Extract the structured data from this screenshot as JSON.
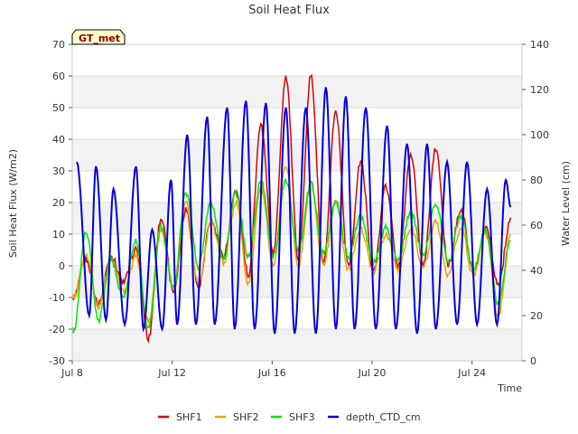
{
  "chart_data": {
    "type": "line",
    "title": "Soil Heat Flux",
    "xlabel": "Time",
    "ylabel": "Soil Heat Flux (W/m2)",
    "y2label": "Water Level (cm)",
    "badge": "GT_met",
    "xlim": [
      8.0,
      26.0
    ],
    "ylim": [
      -30,
      70
    ],
    "y2lim": [
      0,
      140
    ],
    "x_ticks": [
      {
        "x": 8,
        "label": "Jul 8"
      },
      {
        "x": 12,
        "label": "Jul 12"
      },
      {
        "x": 16,
        "label": "Jul 16"
      },
      {
        "x": 20,
        "label": "Jul 20"
      },
      {
        "x": 24,
        "label": "Jul 24"
      }
    ],
    "y_ticks": [
      -30,
      -20,
      -10,
      0,
      10,
      20,
      30,
      40,
      50,
      60,
      70
    ],
    "y2_ticks": [
      0,
      20,
      40,
      60,
      80,
      100,
      120,
      140
    ],
    "grid": "horizontal bands",
    "legend_position": "bottom",
    "series": [
      {
        "name": "SHF1",
        "color": "#dd0000",
        "axis": "left",
        "daily": [
          {
            "day": 8,
            "max": 2,
            "min": -10
          },
          {
            "day": 9,
            "max": 3,
            "min": -12
          },
          {
            "day": 10,
            "max": 5,
            "min": -5
          },
          {
            "day": 11,
            "max": 15,
            "min": -23
          },
          {
            "day": 12,
            "max": 18,
            "min": -8
          },
          {
            "day": 13,
            "max": 14,
            "min": -7
          },
          {
            "day": 14,
            "max": 24,
            "min": 3
          },
          {
            "day": 15,
            "max": 44,
            "min": -3
          },
          {
            "day": 16,
            "max": 60,
            "min": 4
          },
          {
            "day": 17,
            "max": 60,
            "min": 2
          },
          {
            "day": 18,
            "max": 49,
            "min": 0
          },
          {
            "day": 19,
            "max": 33,
            "min": 0
          },
          {
            "day": 20,
            "max": 25,
            "min": -2
          },
          {
            "day": 21,
            "max": 35,
            "min": 0
          },
          {
            "day": 22,
            "max": 37,
            "min": 0
          },
          {
            "day": 23,
            "max": 18,
            "min": 0
          },
          {
            "day": 24,
            "max": 12,
            "min": -2
          },
          {
            "day": 25,
            "max": 15,
            "min": -6
          }
        ]
      },
      {
        "name": "SHF2",
        "color": "#f5a000",
        "axis": "left",
        "daily": [
          {
            "day": 8,
            "max": 3,
            "min": -10
          },
          {
            "day": 9,
            "max": 2,
            "min": -13
          },
          {
            "day": 10,
            "max": 3,
            "min": -8
          },
          {
            "day": 11,
            "max": 12,
            "min": -18
          },
          {
            "day": 12,
            "max": 20,
            "min": -7
          },
          {
            "day": 13,
            "max": 14,
            "min": -6
          },
          {
            "day": 14,
            "max": 20,
            "min": 1
          },
          {
            "day": 15,
            "max": 25,
            "min": -6
          },
          {
            "day": 16,
            "max": 32,
            "min": 0
          },
          {
            "day": 17,
            "max": 26,
            "min": 0
          },
          {
            "day": 18,
            "max": 20,
            "min": 0
          },
          {
            "day": 19,
            "max": 12,
            "min": -1
          },
          {
            "day": 20,
            "max": 10,
            "min": -2
          },
          {
            "day": 21,
            "max": 12,
            "min": -1
          },
          {
            "day": 22,
            "max": 14,
            "min": 0
          },
          {
            "day": 23,
            "max": 12,
            "min": -3
          },
          {
            "day": 24,
            "max": 10,
            "min": -3
          },
          {
            "day": 25,
            "max": 10,
            "min": -16
          }
        ]
      },
      {
        "name": "SHF3",
        "color": "#00e600",
        "axis": "left",
        "daily": [
          {
            "day": 8,
            "max": 11,
            "min": -21
          },
          {
            "day": 9,
            "max": 2,
            "min": -17
          },
          {
            "day": 10,
            "max": 8,
            "min": -10
          },
          {
            "day": 11,
            "max": 12,
            "min": -20
          },
          {
            "day": 12,
            "max": 23,
            "min": -7
          },
          {
            "day": 13,
            "max": 20,
            "min": 0
          },
          {
            "day": 14,
            "max": 23,
            "min": 2
          },
          {
            "day": 15,
            "max": 27,
            "min": 3
          },
          {
            "day": 16,
            "max": 27,
            "min": 3
          },
          {
            "day": 17,
            "max": 26,
            "min": 5
          },
          {
            "day": 18,
            "max": 20,
            "min": 4
          },
          {
            "day": 19,
            "max": 16,
            "min": 3
          },
          {
            "day": 20,
            "max": 12,
            "min": 1
          },
          {
            "day": 21,
            "max": 17,
            "min": 2
          },
          {
            "day": 22,
            "max": 20,
            "min": 3
          },
          {
            "day": 23,
            "max": 16,
            "min": 1
          },
          {
            "day": 24,
            "max": 11,
            "min": -1
          },
          {
            "day": 25,
            "max": 9,
            "min": -12
          }
        ]
      },
      {
        "name": "depth_CTD_cm",
        "color": "#0000dd",
        "axis": "right",
        "tidal_peaks": [
          {
            "x": 8.18,
            "value": 88
          },
          {
            "x": 8.68,
            "value": 20
          },
          {
            "x": 8.95,
            "value": 86
          },
          {
            "x": 9.35,
            "value": 18
          },
          {
            "x": 9.65,
            "value": 76
          },
          {
            "x": 10.1,
            "value": 16
          },
          {
            "x": 10.55,
            "value": 86
          },
          {
            "x": 10.85,
            "value": 14
          },
          {
            "x": 11.2,
            "value": 58
          },
          {
            "x": 11.6,
            "value": 14
          },
          {
            "x": 11.95,
            "value": 80
          },
          {
            "x": 12.2,
            "value": 16
          },
          {
            "x": 12.6,
            "value": 100
          },
          {
            "x": 12.95,
            "value": 16
          },
          {
            "x": 13.4,
            "value": 108
          },
          {
            "x": 13.7,
            "value": 16
          },
          {
            "x": 14.2,
            "value": 112
          },
          {
            "x": 14.5,
            "value": 14
          },
          {
            "x": 14.95,
            "value": 115
          },
          {
            "x": 15.3,
            "value": 14
          },
          {
            "x": 15.75,
            "value": 114
          },
          {
            "x": 16.1,
            "value": 12
          },
          {
            "x": 16.55,
            "value": 112
          },
          {
            "x": 16.9,
            "value": 12
          },
          {
            "x": 17.35,
            "value": 112
          },
          {
            "x": 17.75,
            "value": 12
          },
          {
            "x": 18.15,
            "value": 121
          },
          {
            "x": 18.55,
            "value": 14
          },
          {
            "x": 18.95,
            "value": 117
          },
          {
            "x": 19.3,
            "value": 14
          },
          {
            "x": 19.75,
            "value": 112
          },
          {
            "x": 20.15,
            "value": 14
          },
          {
            "x": 20.6,
            "value": 104
          },
          {
            "x": 20.95,
            "value": 14
          },
          {
            "x": 21.4,
            "value": 96
          },
          {
            "x": 21.8,
            "value": 12
          },
          {
            "x": 22.2,
            "value": 96
          },
          {
            "x": 22.55,
            "value": 14
          },
          {
            "x": 23.0,
            "value": 88
          },
          {
            "x": 23.4,
            "value": 16
          },
          {
            "x": 23.8,
            "value": 88
          },
          {
            "x": 24.2,
            "value": 16
          },
          {
            "x": 24.6,
            "value": 76
          },
          {
            "x": 25.0,
            "value": 16
          },
          {
            "x": 25.35,
            "value": 80
          },
          {
            "x": 25.55,
            "value": 68
          }
        ]
      }
    ]
  }
}
